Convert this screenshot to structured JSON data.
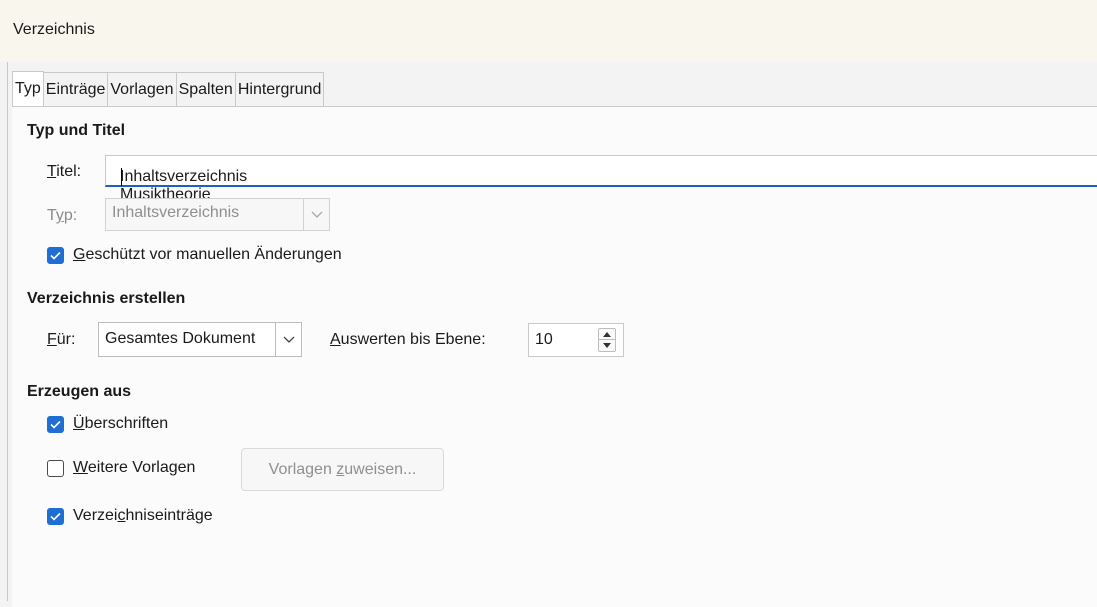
{
  "window": {
    "title": "Verzeichnis"
  },
  "tabs": [
    {
      "label": "Typ",
      "active": true
    },
    {
      "label": "Einträge",
      "active": false
    },
    {
      "label": "Vorlagen",
      "active": false
    },
    {
      "label": "Spalten",
      "active": false
    },
    {
      "label": "Hintergrund",
      "active": false
    }
  ],
  "type_title": {
    "heading": "Typ und Titel",
    "title_label": "Titel:",
    "title_value": "Inhaltsverzeichnis Musiktheorie",
    "type_label": "Typ:",
    "type_value": "Inhaltsverzeichnis",
    "protected_label": "Geschützt vor manuellen Änderungen",
    "protected_checked": true
  },
  "create": {
    "heading": "Verzeichnis erstellen",
    "for_label": "Für:",
    "for_value": "Gesamtes Dokument",
    "level_label": "Auswerten bis Ebene:",
    "level_value": "10"
  },
  "generate": {
    "heading": "Erzeugen aus",
    "headings_label": "Überschriften",
    "headings_checked": true,
    "more_styles_label": "Weitere Vorlagen",
    "more_styles_checked": false,
    "assign_styles_button": "Vorlagen zuweisen...",
    "index_marks_label": "Verzeichniseinträge",
    "index_marks_checked": true
  },
  "colors": {
    "accent": "#1f6ed4",
    "focus_underline": "#1f5fbf",
    "disabled_text": "#8a8a8a"
  }
}
